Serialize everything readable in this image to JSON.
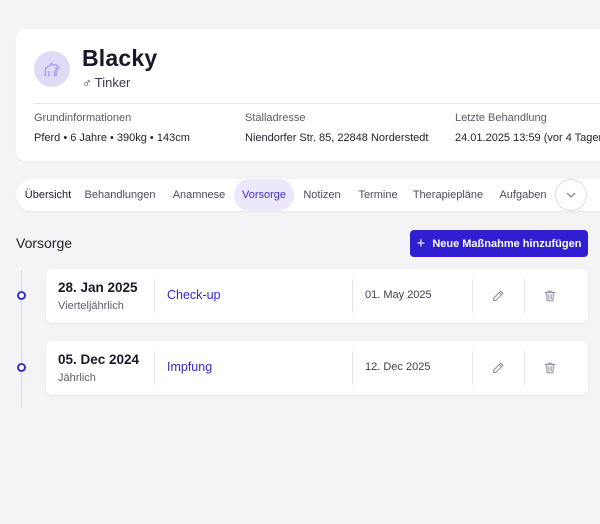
{
  "profile": {
    "name": "Blacky",
    "gender_symbol": "♂",
    "breed": "Tinker",
    "info": [
      {
        "label": "Grundinformationen",
        "value": "Pferd • 6 Jahre • 390kg • 143cm"
      },
      {
        "label": "Stalladresse",
        "value": "Niendorfer Str. 85, 22848 Norderstedt"
      },
      {
        "label": "Letzte Behandlung",
        "value": "24.01.2025 13:59 (vor 4 Tagen)"
      }
    ]
  },
  "tabs": [
    {
      "label": "Übersicht"
    },
    {
      "label": "Behandlungen"
    },
    {
      "label": "Anamnese"
    },
    {
      "label": "Vorsorge",
      "selected": true
    },
    {
      "label": "Notizen"
    },
    {
      "label": "Termine"
    },
    {
      "label": "Therapiepläne"
    },
    {
      "label": "Aufgaben"
    }
  ],
  "section": {
    "title": "Vorsorge",
    "add_button_label": "Neue Maßnahme hinzufügen"
  },
  "entries": [
    {
      "date": "28. Jan 2025",
      "interval": "Vierteljährlich",
      "type": "Check-up",
      "due": "01. May 2025"
    },
    {
      "date": "05. Dec 2024",
      "interval": "Jährlich",
      "type": "Impfung",
      "due": "12. Dec 2025"
    }
  ],
  "colors": {
    "accent": "#2f1fd1",
    "accent_soft": "#ece7fb",
    "avatar_bg": "#dedcf5"
  }
}
